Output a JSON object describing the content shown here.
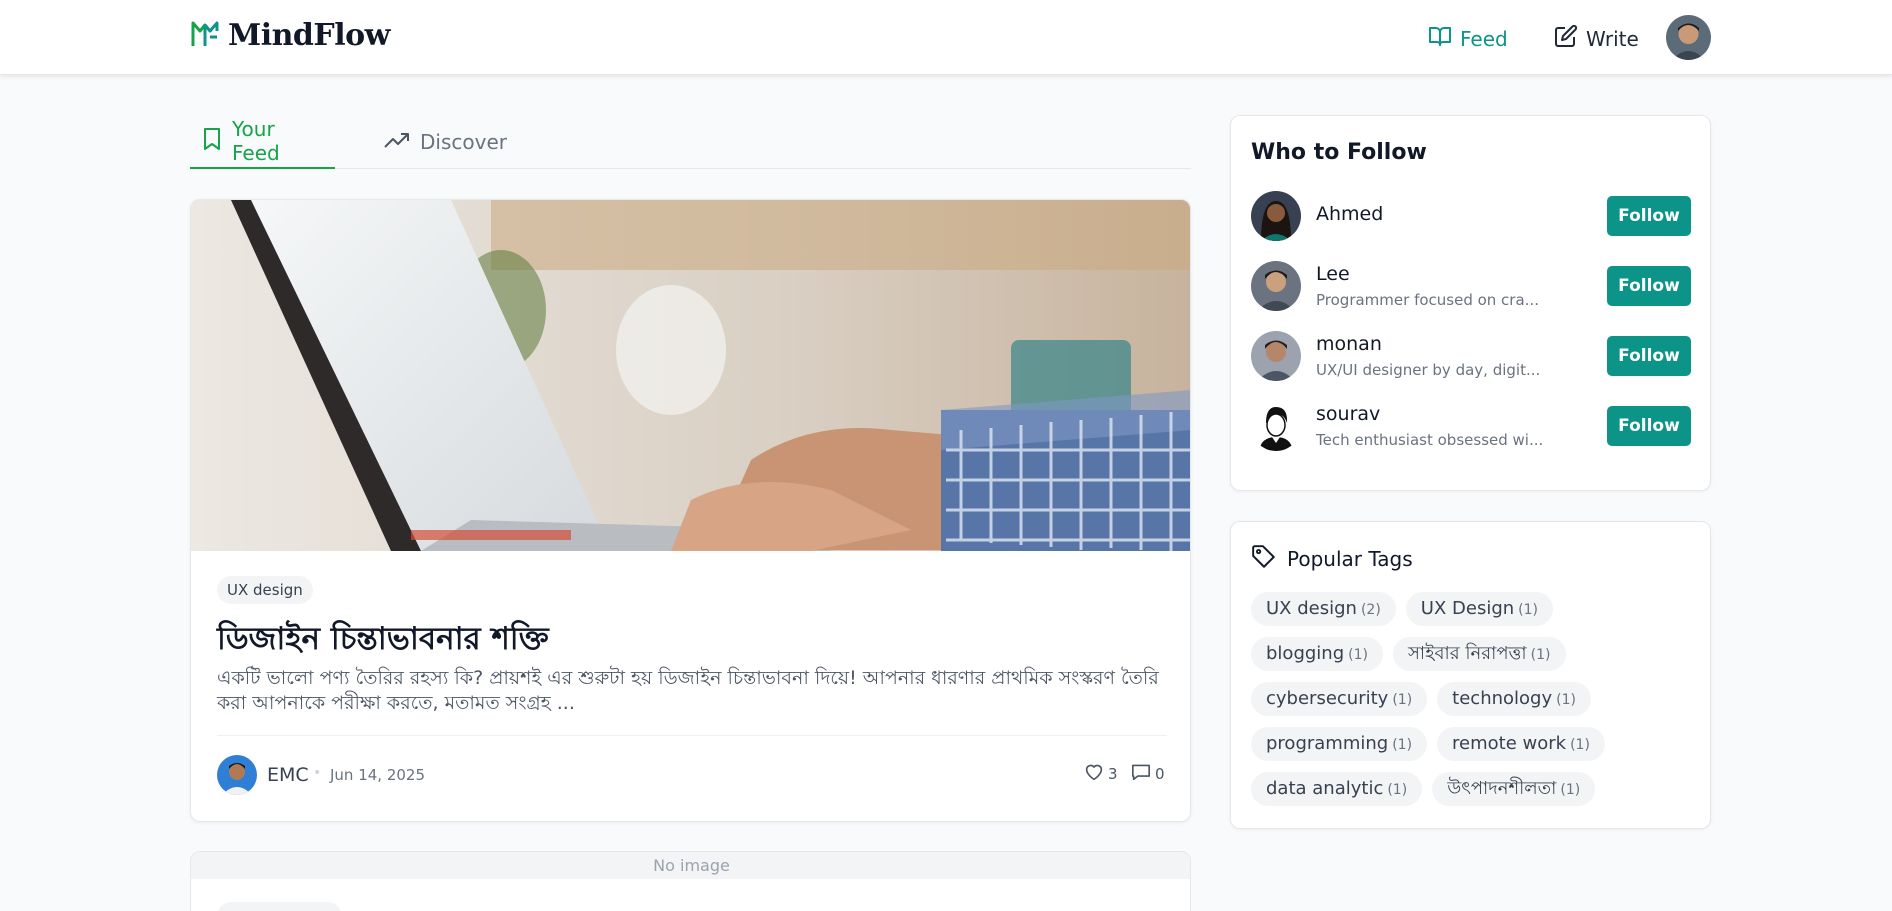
{
  "header": {
    "logo_text": "MindFlow",
    "nav_feed": "Feed",
    "nav_write": "Write"
  },
  "tabs": [
    {
      "label": "Your Feed",
      "active": true
    },
    {
      "label": "Discover",
      "active": false
    }
  ],
  "post": {
    "tag": "UX design",
    "title": "ডিজাইন চিন্তাভাবনার শক্তি",
    "excerpt": "একটি ভালো পণ্য তৈরির রহস্য কি? প্রায়শই এর শুরুটা হয় ডিজাইন চিন্তাভাবনা দিয়ে! আপনার ধারণার প্রাথমিক সংস্করণ তৈরি করা আপনাকে পরীক্ষা করতে, মতামত সংগ্রহ ...",
    "author": "EMC",
    "separator": "•",
    "date": "Jun 14, 2025",
    "likes": "3",
    "comments": "0"
  },
  "post2": {
    "no_image": "No image"
  },
  "who_to_follow": {
    "title": "Who to Follow",
    "users": [
      {
        "name": "Ahmed",
        "bio": "",
        "button": "Follow"
      },
      {
        "name": "Lee",
        "bio": "Programmer focused on cra...",
        "button": "Follow"
      },
      {
        "name": "monan",
        "bio": "UX/UI designer by day, digit...",
        "button": "Follow"
      },
      {
        "name": "sourav",
        "bio": "Tech enthusiast obsessed wi...",
        "button": "Follow"
      }
    ]
  },
  "popular_tags": {
    "title": "Popular Tags",
    "tags": [
      {
        "name": "UX design",
        "count": "(2)"
      },
      {
        "name": "UX Design",
        "count": "(1)"
      },
      {
        "name": "blogging",
        "count": "(1)"
      },
      {
        "name": "সাইবার নিরাপত্তা",
        "count": "(1)"
      },
      {
        "name": "cybersecurity",
        "count": "(1)"
      },
      {
        "name": "technology",
        "count": "(1)"
      },
      {
        "name": "programming",
        "count": "(1)"
      },
      {
        "name": "remote work",
        "count": "(1)"
      },
      {
        "name": "data analytic",
        "count": "(1)"
      },
      {
        "name": "উৎপাদনশীলতা",
        "count": "(1)"
      }
    ]
  },
  "colors": {
    "accent": "#0d9488",
    "active_tab": "#16a34a"
  }
}
